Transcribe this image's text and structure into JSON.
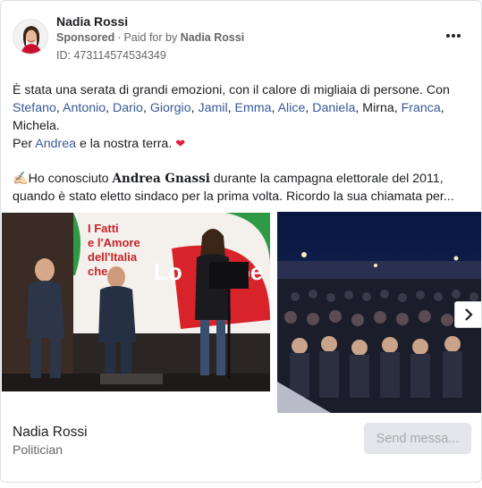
{
  "header": {
    "page_name": "Nadia Rossi",
    "sponsored": "Sponsored",
    "paid_for_prefix": "Paid for by",
    "paid_for_name": "Nadia Rossi",
    "ad_id": "ID: 473114574534349"
  },
  "post": {
    "intro": "È stata una serata di grandi emozioni, con il calore di migliaia di persone. Con",
    "names": [
      "Stefano",
      "Antonio",
      "Dario",
      "Giorgio",
      "Jamil",
      "Emma",
      "Alice",
      "Daniela"
    ],
    "names_trailing": "Mirna",
    "name_last": "Franca",
    "name_after": "Michela.",
    "per": "Per",
    "per_name": "Andrea",
    "per_rest": "e la nostra terra.",
    "heart": "❤",
    "hand_emoji": "✍🏻",
    "p2_prefix": "Ho conosciuto",
    "p2_bold": "Andrea Gnassi",
    "p2_rest": "durante la campagna elettorale del 2011, quando è stato eletto sindaco per la prima volta. Ricordo la sua chiamata per..."
  },
  "carousel": {
    "slide1_banner_line1": "I Fatti",
    "slide1_banner_line2": "e l'Amore",
    "slide1_banner_line3": "dell'Italia",
    "slide1_banner_line4": "che",
    "slide1_banner_big": "Lo",
    "slide1_banner_big2": "pe"
  },
  "footer": {
    "name": "Nadia Rossi",
    "subtitle": "Politician",
    "send_label": "Send messa..."
  },
  "colors": {
    "link": "#385898",
    "muted": "#65676b",
    "heart": "#e41e3f",
    "button_bg": "#e4e6eb"
  },
  "icons": [
    "more-options-icon",
    "heart-icon",
    "writing-hand-icon",
    "chevron-right-icon"
  ]
}
